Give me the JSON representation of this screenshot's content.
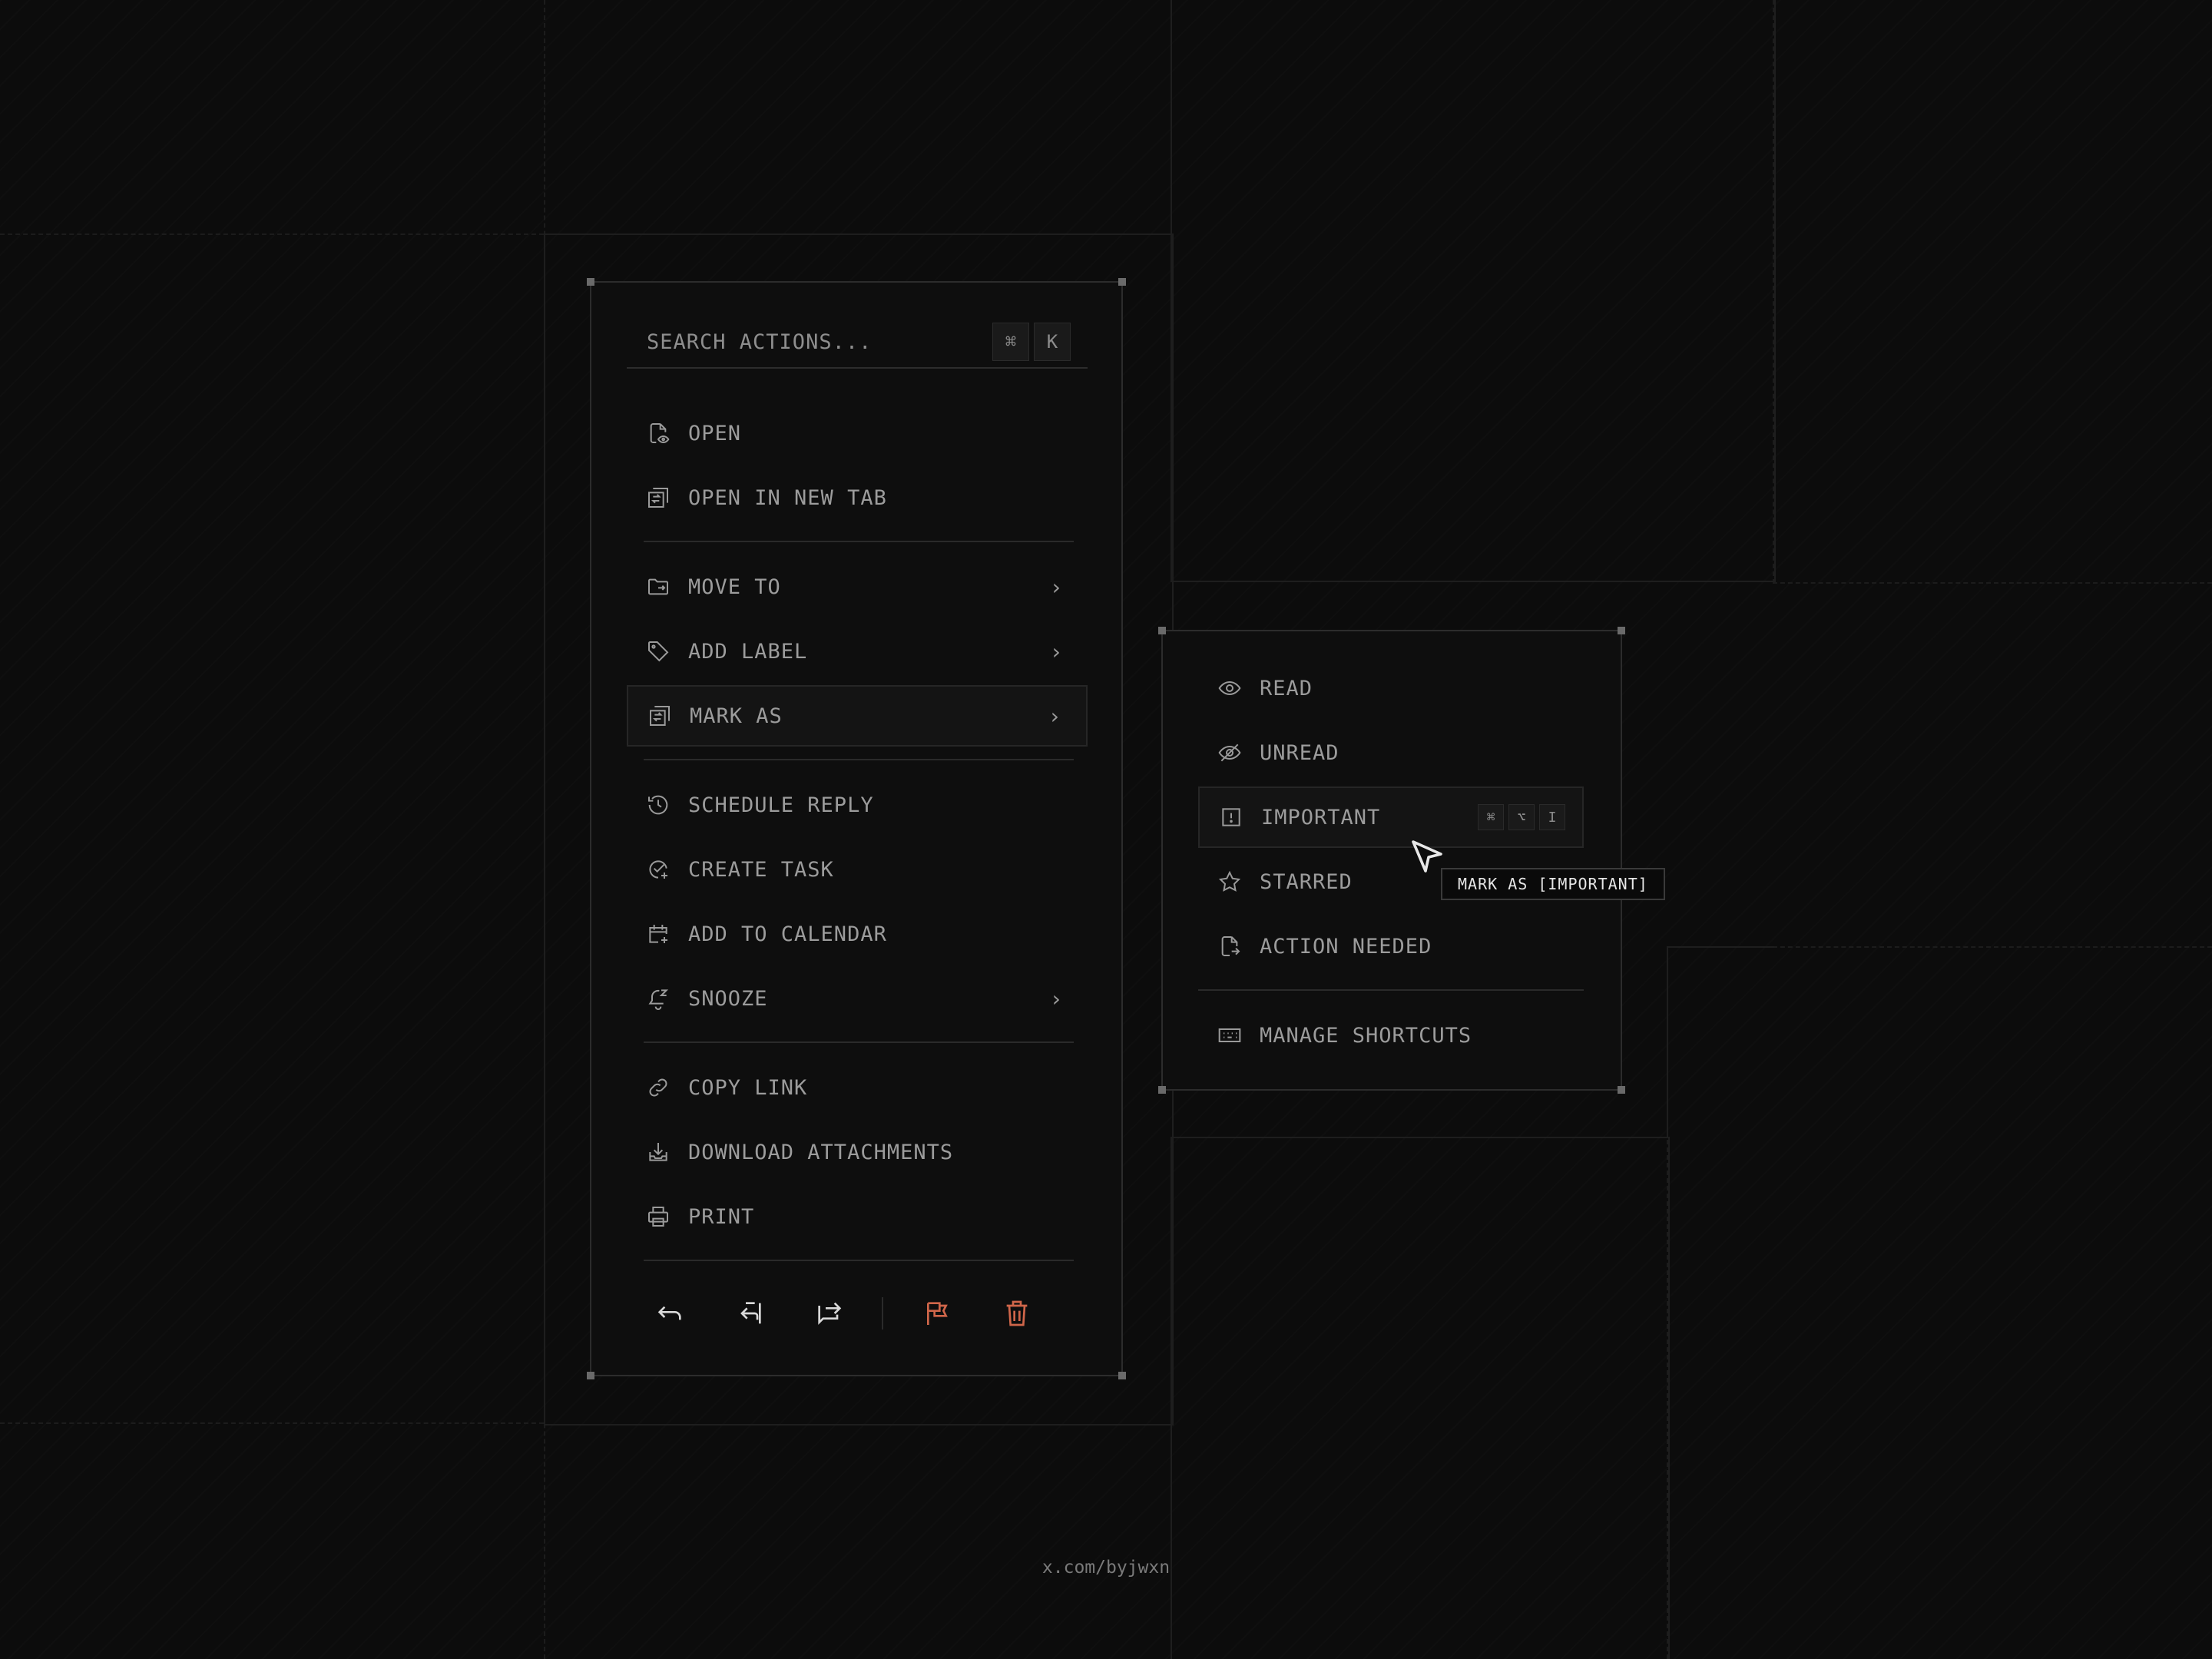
{
  "search": {
    "placeholder": "SEARCH ACTIONS...",
    "shortcut_keys": [
      "⌘",
      "K"
    ]
  },
  "menu": {
    "items": [
      {
        "label": "OPEN",
        "icon": "file-eye-icon"
      },
      {
        "label": "OPEN IN NEW TAB",
        "icon": "open-new-tab-icon"
      },
      {
        "label": "MOVE TO",
        "icon": "folder-move-icon",
        "chevron": "›"
      },
      {
        "label": "ADD LABEL",
        "icon": "tag-icon",
        "chevron": "›"
      },
      {
        "label": "MARK AS",
        "icon": "mark-as-icon",
        "chevron": "›"
      },
      {
        "label": "SCHEDULE REPLY",
        "icon": "clock-history-icon"
      },
      {
        "label": "CREATE TASK",
        "icon": "task-check-icon"
      },
      {
        "label": "ADD TO CALENDAR",
        "icon": "calendar-plus-icon"
      },
      {
        "label": "SNOOZE",
        "icon": "bell-snooze-icon",
        "chevron": "›"
      },
      {
        "label": "COPY LINK",
        "icon": "link-icon"
      },
      {
        "label": "DOWNLOAD ATTACHMENTS",
        "icon": "download-tray-icon"
      },
      {
        "label": "PRINT",
        "icon": "printer-icon"
      }
    ],
    "active_item": "MARK AS"
  },
  "toolbar": {
    "actions": [
      "reply-icon",
      "reply-all-icon",
      "forward-icon",
      "flag-icon",
      "trash-icon"
    ],
    "danger_color": "#d0664a"
  },
  "submenu": {
    "items": [
      {
        "label": "READ",
        "icon": "eye-icon"
      },
      {
        "label": "UNREAD",
        "icon": "eye-off-icon"
      },
      {
        "label": "IMPORTANT",
        "icon": "important-square-icon",
        "shortcut": [
          "⌘",
          "⌥",
          "I"
        ]
      },
      {
        "label": "STARRED",
        "icon": "star-icon"
      },
      {
        "label": "ACTION NEEDED",
        "icon": "file-action-icon"
      },
      {
        "label": "MANAGE SHORTCUTS",
        "icon": "keyboard-icon"
      }
    ],
    "active_item": "IMPORTANT"
  },
  "tooltip": {
    "text": "MARK AS [IMPORTANT]"
  },
  "footer": {
    "credit": "x.com/byjwxn"
  }
}
